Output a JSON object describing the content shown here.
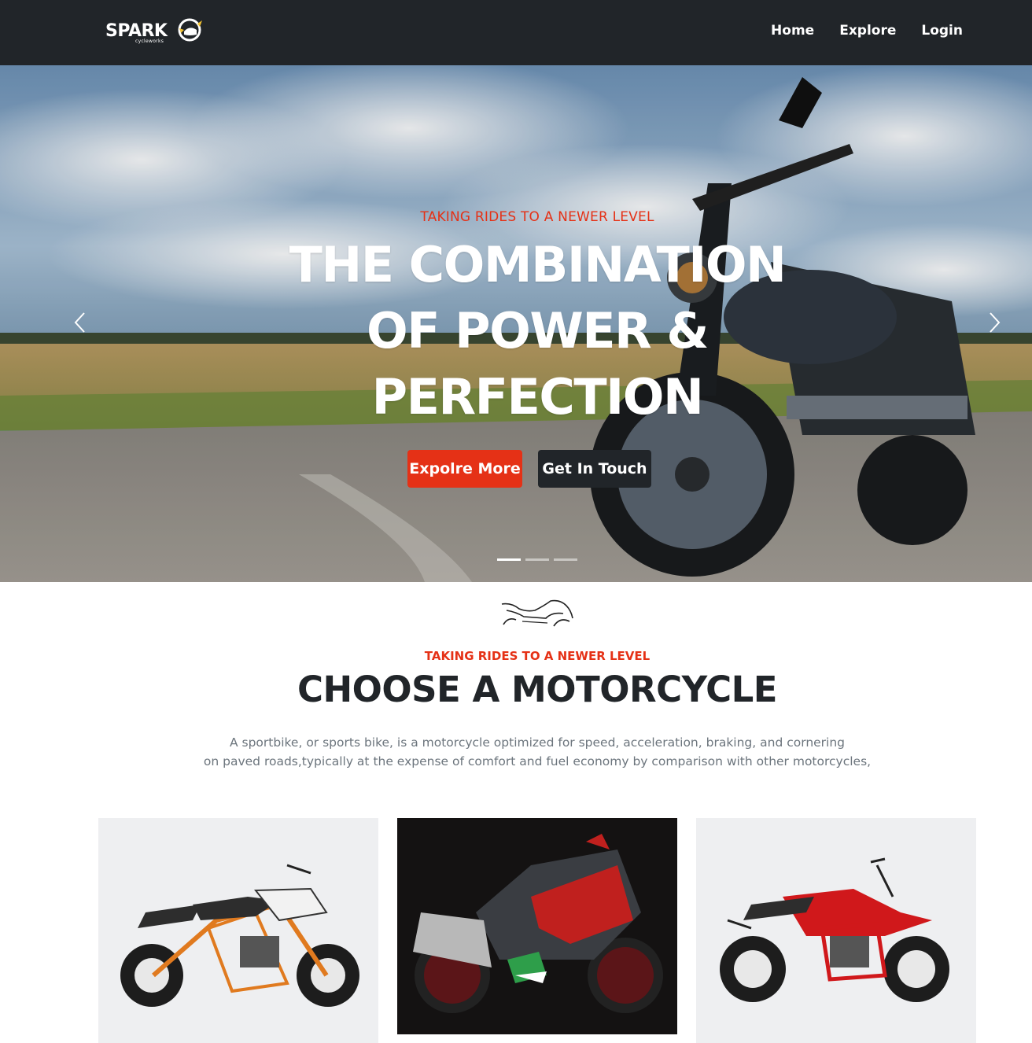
{
  "nav": {
    "logo_text": "SPARK",
    "logo_sub": "cycleworks",
    "links": [
      "Home",
      "Explore",
      "Login"
    ]
  },
  "hero": {
    "subtitle": "TAKING RIDES TO A NEWER LEVEL",
    "title": "THE COMBINATION OF POWER & PERFECTION",
    "buttons": {
      "explore": "Expolre More",
      "touch": "Get In Touch"
    },
    "slides": 3,
    "active_slide": 1
  },
  "section": {
    "subtitle": "TAKING RIDES TO A NEWER LEVEL",
    "title": "CHOOSE A MOTORCYCLE",
    "description_line1": "A sportbike, or sports bike, is a motorcycle optimized for speed, acceleration, braking, and cornering",
    "description_line2": "on paved roads,typically at the expense of comfort and fuel economy by comparison with other motorcycles,"
  },
  "colors": {
    "accent": "#e53116",
    "dark": "#212529",
    "muted": "#6c757d"
  },
  "icons": {
    "prev": "chevron-left-icon",
    "next": "chevron-right-icon",
    "section": "sportbike-icon"
  }
}
